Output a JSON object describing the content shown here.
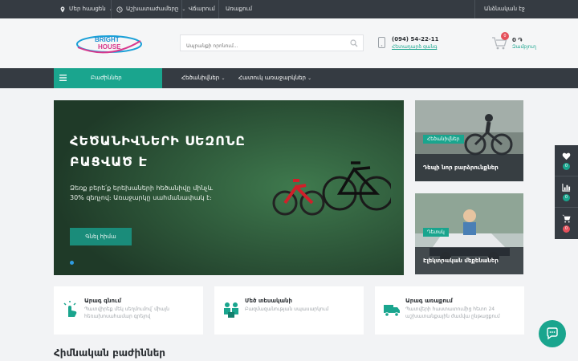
{
  "topbar": {
    "city": "Մեր հասցեն",
    "hours": "Աշխատաժամերը",
    "delivery": "Առաքում",
    "payment": "Վճարում",
    "not_member": "Անձնական էջ",
    "location_icon": "location-pin-icon",
    "clock_icon": "clock-icon"
  },
  "header": {
    "logo_line1": "BRIGHT",
    "logo_line2": "HOUSE",
    "search_placeholder": "Ապրանքի որոնում...",
    "phone": "(094) 54-22-11",
    "callback": "Հետադարձ զանգ",
    "cart_count": "0",
    "cart_sum": "0 ֏",
    "cart_label": "Զամբյուղ"
  },
  "nav": {
    "categories": "Բաժիններ",
    "items": [
      "Հեծանիվներ",
      "Հատուկ առաջարկներ"
    ]
  },
  "hero": {
    "title": "ՀԵԾԱՆԻՎՆԵՐԻ ՍԵԶՈՆԸ ԲԱՑՎԱԾ Է",
    "text": "Ձեռք բերե՛ք երեխաների հեծանիվը մինչև 30% զեղչով։ Առաջարկը սահմանափակ է։",
    "button": "Գնել հիմա"
  },
  "promos": [
    {
      "tag": "Հեծանիվներ",
      "caption": "Դեպի նոր բարձրունքներ"
    },
    {
      "tag": "Դետսկ",
      "caption": "Էլեկտրական մեքենաներ"
    }
  ],
  "features": [
    {
      "title": "Արագ գնում",
      "desc": "Պատվիրեք մեկ սեղմումով՝ միայն հեռախոսահամար գրելով",
      "icon": "click-hand-icon"
    },
    {
      "title": "Մեծ տեսականի",
      "desc": "Բազմազանության սպասարկում",
      "icon": "people-boxes-icon"
    },
    {
      "title": "Արագ առաքում",
      "desc": "Պատվերի հաստատումից հետո 24 աշխատանքային ժամվա ընթացքում",
      "icon": "truck-icon"
    }
  ],
  "section_title": "Հիմնական բաժիններ",
  "side": {
    "wishlist_count": "0",
    "compare_count": "0",
    "cart_count": "0"
  },
  "colors": {
    "accent": "#1aa58e",
    "dark": "#353b42",
    "badge_red": "#e5505b",
    "badge_green": "#1aa58e"
  }
}
